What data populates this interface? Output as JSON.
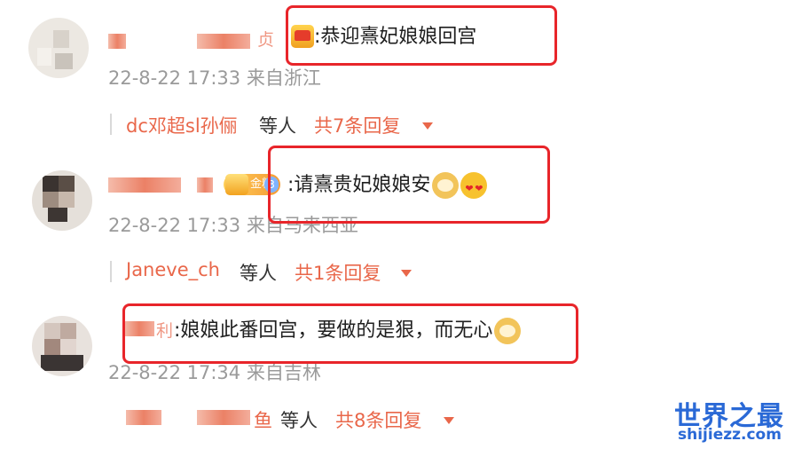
{
  "comments": [
    {
      "name_tail": "贞",
      "text": ":恭迎熹妃娘娘回宫",
      "meta": "22-8-22 17:33 来自浙江",
      "reply": {
        "names": "dc邓超sl孙俪",
        "middle": "等人",
        "count": "共7条回复"
      }
    },
    {
      "badge_label": "金粉",
      "badge_level": "3",
      "text": ":请熹贵妃娘娘安",
      "meta": "22-8-22 17:33 来自马来西亚",
      "reply": {
        "names": "Janeve_ch",
        "middle": "等人",
        "count": "共1条回复"
      }
    },
    {
      "name_tail": "利",
      "text": ":娘娘此番回宫，要做的是狠，而无心",
      "meta": "22-8-22 17:34 来自吉林",
      "reply": {
        "names_tail": "鱼",
        "middle": "等人",
        "count": "共8条回复"
      }
    }
  ],
  "watermark": {
    "title": "世界之最",
    "url": "shijiezz.com"
  },
  "colors": {
    "highlight": "#e8252a",
    "link": "#e9674a",
    "meta": "#9a9a9a",
    "watermark": "#2a69d6"
  },
  "icons": [
    "avatar",
    "crown-badge",
    "gold-fan-badge",
    "dog-emoji",
    "heart-eyes-emoji",
    "expand-caret-icon"
  ]
}
